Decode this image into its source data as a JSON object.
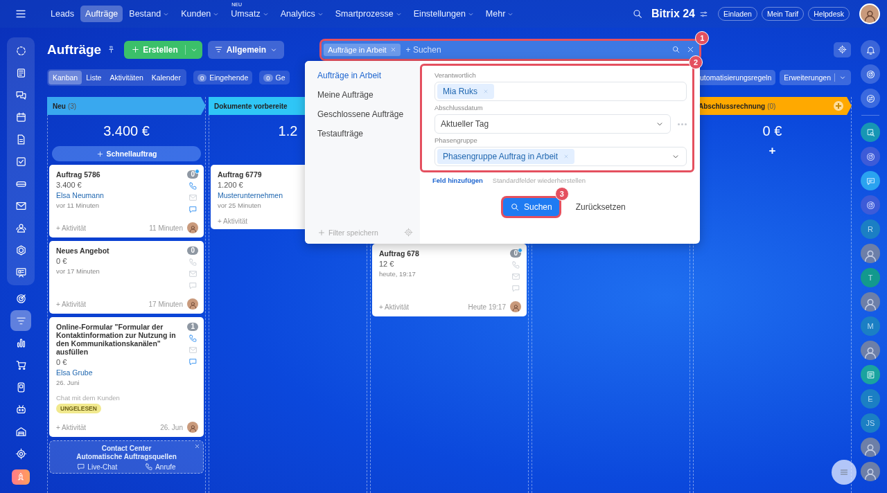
{
  "topnav": {
    "items": [
      {
        "label": "Leads",
        "selected": false,
        "dropdown": false
      },
      {
        "label": "Aufträge",
        "selected": true,
        "dropdown": false
      },
      {
        "label": "Bestand",
        "selected": false,
        "dropdown": true
      },
      {
        "label": "Kunden",
        "selected": false,
        "dropdown": true
      },
      {
        "label": "Umsatz",
        "selected": false,
        "dropdown": true,
        "badge": "NEU"
      },
      {
        "label": "Analytics",
        "selected": false,
        "dropdown": true
      },
      {
        "label": "Smartprozesse",
        "selected": false,
        "dropdown": true
      },
      {
        "label": "Einstellungen",
        "selected": false,
        "dropdown": true
      },
      {
        "label": "Mehr",
        "selected": false,
        "dropdown": true
      }
    ],
    "logo": "Bitrix 24",
    "buttons": [
      "Einladen",
      "Mein Tarif",
      "Helpdesk"
    ]
  },
  "left_rail": {
    "group": [
      {
        "kind": "dots-circle",
        "selected": false
      },
      {
        "kind": "newspaper",
        "selected": false
      },
      {
        "kind": "chat-bubbles",
        "selected": false
      },
      {
        "kind": "calendar",
        "selected": false
      },
      {
        "kind": "document",
        "selected": false
      },
      {
        "kind": "checkbox",
        "selected": false
      },
      {
        "kind": "drive",
        "selected": false
      },
      {
        "kind": "envelope",
        "selected": false
      },
      {
        "kind": "people",
        "selected": false
      },
      {
        "kind": "hexagon",
        "selected": false
      },
      {
        "kind": "presentation-board",
        "selected": false
      }
    ],
    "items": [
      {
        "kind": "target",
        "selected": false
      },
      {
        "kind": "filter",
        "selected": true
      },
      {
        "kind": "bar-chart",
        "selected": false
      },
      {
        "kind": "cart",
        "selected": false
      },
      {
        "kind": "device",
        "selected": false
      },
      {
        "kind": "robot",
        "selected": false
      },
      {
        "kind": "garage",
        "selected": false
      },
      {
        "kind": "settings",
        "selected": false
      }
    ],
    "launcher": {
      "kind": "rocket"
    }
  },
  "page": {
    "title": "Aufträge",
    "create_button": "Erstellen",
    "category_button": "Allgemein"
  },
  "filter": {
    "chip": "Aufträge in Arbeit",
    "placeholder": "+ Suchen",
    "callout": "1"
  },
  "view_tabs": [
    {
      "label": "Kanban",
      "selected": true
    },
    {
      "label": "Liste",
      "selected": false
    },
    {
      "label": "Aktivitäten",
      "selected": false
    },
    {
      "label": "Kalender",
      "selected": false
    }
  ],
  "counters": [
    {
      "count": "0",
      "label": "Eingehende"
    },
    {
      "count": "0",
      "label": "Ge"
    }
  ],
  "automation_button": "utomatisierungsregeln",
  "extensions_button": "Erweiterungen",
  "columns": [
    {
      "title": "Neu",
      "count": "(3)",
      "color": "#39a8ef",
      "total": "3.400 €",
      "covered": false,
      "quick_add": {
        "kind": "button",
        "label": "Schnellauftrag"
      },
      "cards": [
        {
          "title": "Auftrag 5786",
          "amount": "3.400 €",
          "contact": "Elsa Neumann",
          "time": "vor 11 Minuten",
          "counter": "0",
          "unread_dot": true,
          "phone_active": true,
          "chat_active": true,
          "activity": "+ Aktivität",
          "footer_time": "11 Minuten"
        },
        {
          "title": "Neues Angebot",
          "amount": "0 €",
          "time": "vor 17 Minuten",
          "counter": "0",
          "unread_dot": false,
          "phone_active": false,
          "chat_active": false,
          "activity": "+ Aktivität",
          "footer_time": "17 Minuten"
        },
        {
          "title": "Online-Formular \"Formular der Kontaktinformation zur Nutzung in den Kommunikationskanälen\" ausfüllen",
          "amount": "0 €",
          "contact": "Elsa Grube",
          "time": "26. Juni",
          "note": "Chat mit dem Kunden",
          "tag": "UNGELESEN",
          "counter": "1",
          "unread_dot": false,
          "phone_active": true,
          "chat_active": true,
          "activity": "+ Aktivität",
          "footer_time": "26. Jun"
        }
      ],
      "promo": {
        "title": "Contact Center",
        "subtitle": "Automatische Auftragsquellen",
        "sources": [
          "Live-Chat",
          "Anrufe"
        ]
      }
    },
    {
      "title": "Dokumente vorbereite",
      "color": "#2fc6f6",
      "total": "1.2",
      "covered": false,
      "cards": [
        {
          "title": "Auftrag 6779",
          "amount": "1.200 €",
          "contact": "Musterunternehmen",
          "time": "vor 25 Minuten",
          "activity": "+ Aktivität"
        }
      ]
    },
    {
      "covered": true,
      "cards": [
        {
          "title": "Auftrag 678",
          "amount": "12 €",
          "time": "heute, 19:17",
          "counter": "0",
          "unread_dot": true,
          "phone_active": false,
          "chat_active": false,
          "activity": "+ Aktivität",
          "footer_time": "Heute 19:17"
        }
      ]
    },
    {
      "kind": "empty"
    },
    {
      "title": "Abschlussrechnung",
      "count": "(0)",
      "color": "#ffa900",
      "total": "0 €",
      "covered": false,
      "quick_add": {
        "kind": "plus",
        "label": "+"
      }
    }
  ],
  "filter_popup": {
    "presets": [
      {
        "label": "Aufträge in Arbeit",
        "selected": true
      },
      {
        "label": "Meine Aufträge",
        "selected": false
      },
      {
        "label": "Geschlossene Aufträge",
        "selected": false
      },
      {
        "label": "Testaufträge",
        "selected": false
      }
    ],
    "save_filter": "Filter speichern",
    "fields_callout": "2",
    "fields": [
      {
        "kind": "tags",
        "label": "Verantwortlich",
        "tags": [
          "Mia Ruks"
        ]
      },
      {
        "kind": "select",
        "label": "Abschlussdatum",
        "value": "Aktueller Tag"
      },
      {
        "kind": "tags-select",
        "label": "Phasengruppe",
        "tags": [
          "Phasengruppe Auftrag in Arbeit"
        ]
      }
    ],
    "add_field": "Feld hinzufügen",
    "restore_fields": "Standardfelder wiederherstellen",
    "search_button": "Suchen",
    "search_callout": "3",
    "reset_button": "Zurücksetzen"
  },
  "right_rail": {
    "tools": [
      {
        "kind": "bell"
      },
      {
        "kind": "ring"
      },
      {
        "kind": "chat-swap"
      }
    ],
    "contacts": [
      {
        "kind": "app-search"
      },
      {
        "kind": "app-ring"
      },
      {
        "kind": "app-chat"
      },
      {
        "kind": "app-ring"
      },
      {
        "kind": "letter",
        "text": "R"
      },
      {
        "kind": "photo"
      },
      {
        "kind": "letter-hex",
        "text": "T"
      },
      {
        "kind": "photo"
      },
      {
        "kind": "letter",
        "text": "M"
      },
      {
        "kind": "photo"
      },
      {
        "kind": "app-news"
      },
      {
        "kind": "letter",
        "text": "E"
      },
      {
        "kind": "letter",
        "text": "JS"
      },
      {
        "kind": "photo"
      },
      {
        "kind": "photo"
      }
    ]
  }
}
